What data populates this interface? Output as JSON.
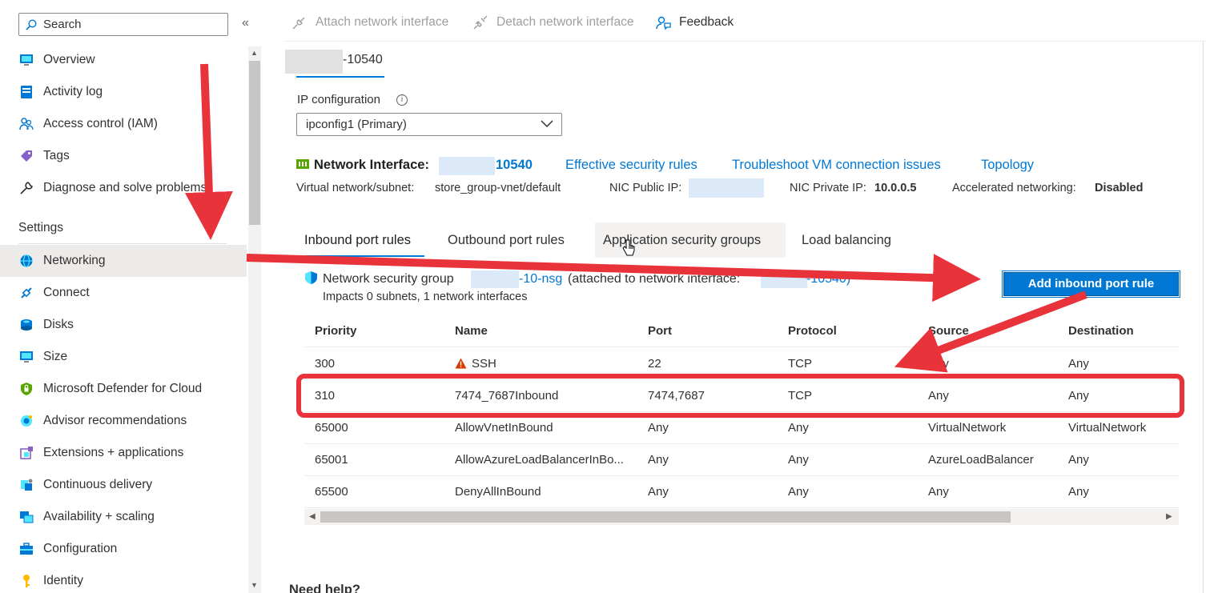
{
  "sidebar": {
    "search_placeholder": "Search",
    "collapse_glyph": "«",
    "items_top": [
      {
        "label": "Overview",
        "icon": "monitor-icon"
      },
      {
        "label": "Activity log",
        "icon": "log-icon"
      },
      {
        "label": "Access control (IAM)",
        "icon": "people-icon"
      },
      {
        "label": "Tags",
        "icon": "tag-icon"
      },
      {
        "label": "Diagnose and solve problems",
        "icon": "wrench-icon"
      }
    ],
    "settings_header": "Settings",
    "items_settings": [
      {
        "label": "Networking",
        "icon": "globe-network-icon",
        "active": true
      },
      {
        "label": "Connect",
        "icon": "connect-icon"
      },
      {
        "label": "Disks",
        "icon": "disks-icon"
      },
      {
        "label": "Size",
        "icon": "monitor-icon"
      },
      {
        "label": "Microsoft Defender for Cloud",
        "icon": "shield-icon"
      },
      {
        "label": "Advisor recommendations",
        "icon": "advisor-icon"
      },
      {
        "label": "Extensions + applications",
        "icon": "extensions-icon"
      },
      {
        "label": "Continuous delivery",
        "icon": "delivery-icon"
      },
      {
        "label": "Availability + scaling",
        "icon": "scaling-icon"
      },
      {
        "label": "Configuration",
        "icon": "toolbox-icon"
      },
      {
        "label": "Identity",
        "icon": "key-icon"
      }
    ]
  },
  "toolbar": {
    "attach_label": "Attach network interface",
    "detach_label": "Detach network interface",
    "feedback_label": "Feedback"
  },
  "nic_tab": {
    "label": "-10540"
  },
  "ip_configuration": {
    "label": "IP configuration",
    "info_glyph": "i",
    "selected": "ipconfig1 (Primary)"
  },
  "network_interface": {
    "title": "Network Interface:",
    "name_suffix": "10540",
    "links": {
      "effective_rules": "Effective security rules",
      "troubleshoot": "Troubleshoot VM connection issues",
      "topology": "Topology"
    },
    "vnet_label": "Virtual network/subnet:",
    "vnet_value": "store_group-vnet/default",
    "public_ip_label": "NIC Public IP:",
    "private_ip_label": "NIC Private IP:",
    "private_ip_value": "10.0.0.5",
    "accel_label": "Accelerated networking:",
    "accel_value": "Disabled"
  },
  "tabs": [
    {
      "label": "Inbound port rules"
    },
    {
      "label": "Outbound port rules"
    },
    {
      "label": "Application security groups"
    },
    {
      "label": "Load balancing"
    }
  ],
  "nsg": {
    "prefix": "Network security group",
    "nsg_suffix": "-10-nsg",
    "attached_text": "(attached to network interface:",
    "nic_suffix": "-10540)",
    "impacts": "Impacts 0 subnets, 1 network interfaces",
    "add_button": "Add inbound port rule"
  },
  "table": {
    "headers": [
      "Priority",
      "Name",
      "Port",
      "Protocol",
      "Source",
      "Destination"
    ],
    "rows": [
      {
        "priority": "300",
        "name": "SSH",
        "warning": true,
        "port": "22",
        "protocol": "TCP",
        "source": "Any",
        "destination": "Any"
      },
      {
        "priority": "310",
        "name": "7474_7687Inbound",
        "warning": false,
        "port": "7474,7687",
        "protocol": "TCP",
        "source": "Any",
        "destination": "Any",
        "highlighted": true
      },
      {
        "priority": "65000",
        "name": "AllowVnetInBound",
        "warning": false,
        "port": "Any",
        "protocol": "Any",
        "source": "VirtualNetwork",
        "destination": "VirtualNetwork"
      },
      {
        "priority": "65001",
        "name": "AllowAzureLoadBalancerInBo...",
        "warning": false,
        "port": "Any",
        "protocol": "Any",
        "source": "AzureLoadBalancer",
        "destination": "Any"
      },
      {
        "priority": "65500",
        "name": "DenyAllInBound",
        "warning": false,
        "port": "Any",
        "protocol": "Any",
        "source": "Any",
        "destination": "Any"
      }
    ]
  },
  "need_help": "Need help?",
  "colors": {
    "accent": "#0078d4",
    "annotation": "#e8333a",
    "warning": "#d83b01"
  }
}
